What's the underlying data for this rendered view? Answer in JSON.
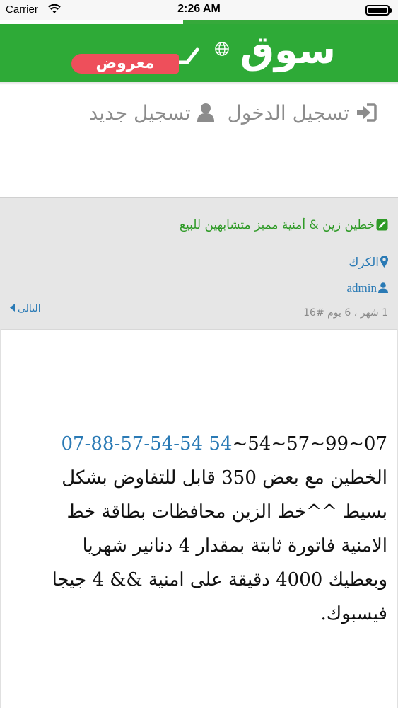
{
  "status_bar": {
    "carrier": "Carrier",
    "time": "2:26 AM",
    "battery_level": 1.0
  },
  "page_load_progress": 0.54,
  "header": {
    "logo_main": "سوق",
    "logo_badge": "معروض",
    "brand_color": "#2eaa37",
    "badge_color": "#ee4f5b"
  },
  "auth_nav": {
    "login_label": "تسجيل الدخول",
    "register_label": "تسجيل جديد",
    "login_icon": "sign-in-icon",
    "register_icon": "user-icon"
  },
  "listing": {
    "title": "خطين زين & أمنية مميز متشابهين للبيع",
    "title_icon": "edit-icon",
    "location": "الكرك",
    "location_icon": "map-marker-icon",
    "author": "admin",
    "author_icon": "user-icon",
    "meta": "1 شهر ، 6 يوم  #16",
    "next_label": "التالى",
    "description": {
      "phone_dark": "07~99~57~54~",
      "phone_blue": "54 07-88-57-54-54",
      "lines": [
        "الخطين مع بعض 350 قابل للتفاوض بشكل",
        "بسيط ^^خط الزين محافظات بطاقة خط",
        "الامنية فاتورة ثابتة بمقدار 4 دنانير شهريا",
        "وبعطيك 4000 دقيقة على امنية && 4 جيجا",
        "فيسبوك."
      ]
    }
  },
  "colors": {
    "link_blue": "#2a7ab5",
    "title_green": "#2e9a26",
    "muted_gray": "#8c8c8c"
  }
}
